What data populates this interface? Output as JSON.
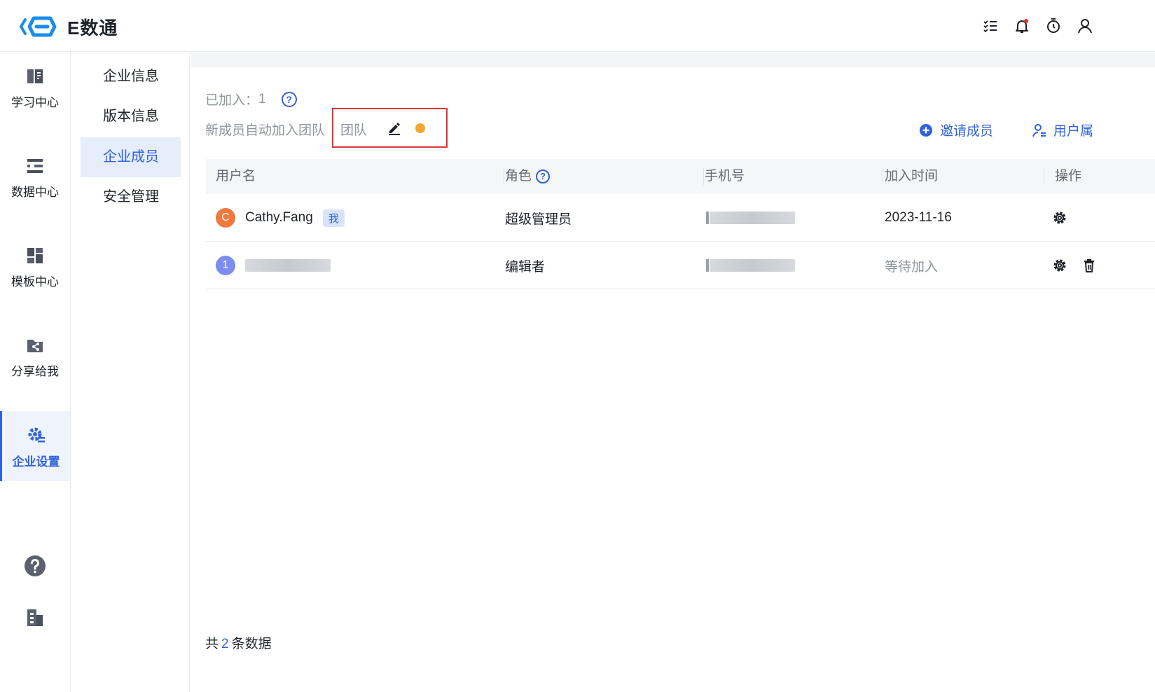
{
  "app": {
    "logo_text": "E数通",
    "brand_color": "#2f63d9"
  },
  "header": {
    "icons": [
      "task-list-icon",
      "bell-icon",
      "timer-icon",
      "user-icon"
    ]
  },
  "rail": {
    "items": [
      {
        "label": "学习中心",
        "icon": "book-icon"
      },
      {
        "label": "数据中心",
        "icon": "database-icon"
      },
      {
        "label": "模板中心",
        "icon": "template-icon"
      },
      {
        "label": "分享给我",
        "icon": "share-folder-icon"
      },
      {
        "label": "企业设置",
        "icon": "settings-icon",
        "active": true
      }
    ],
    "bottom_icons": [
      "help-icon",
      "building-icon"
    ]
  },
  "subnav": {
    "items": [
      {
        "label": "企业信息"
      },
      {
        "label": "版本信息"
      },
      {
        "label": "企业成员",
        "active": true
      },
      {
        "label": "安全管理"
      }
    ]
  },
  "members": {
    "joined_label": "已加入：",
    "joined_count": "1",
    "auto_join_label": "新成员自动加入团队",
    "team_value": "团队",
    "invite_label": "邀请成员",
    "user_attr_label": "用户属"
  },
  "table": {
    "headers": {
      "username": "用户名",
      "role": "角色",
      "phone": "手机号",
      "join_time": "加入时间",
      "action": "操作"
    },
    "rows": [
      {
        "avatar": "C",
        "avatar_color": "#f0793c",
        "name": "Cathy.Fang",
        "badge": "我",
        "role": "超级管理员",
        "join_time": "2023-11-16"
      },
      {
        "avatar": "1",
        "avatar_color": "#7d8cf0",
        "name": "",
        "badge": "",
        "role": "编辑者",
        "join_time": "等待加入"
      }
    ]
  },
  "footer": {
    "prefix": "共",
    "count": "2",
    "suffix": "条数据"
  }
}
